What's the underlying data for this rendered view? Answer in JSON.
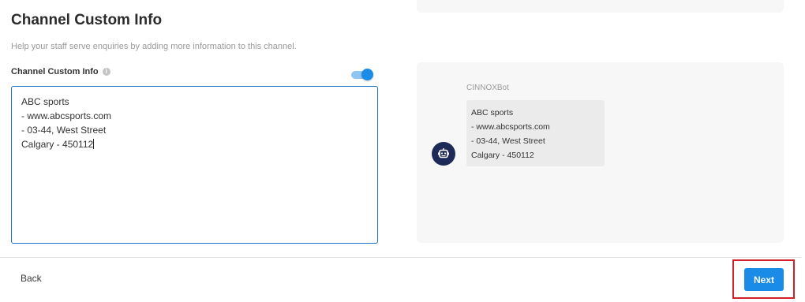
{
  "page": {
    "title": "Channel Custom Info",
    "subtitle": "Help your staff serve enquiries by adding more information to this channel."
  },
  "form": {
    "field_label": "Channel Custom Info",
    "info_icon": "i",
    "toggle_on": true,
    "textarea_value": "ABC sports\n- www.abcsports.com\n- 03-44, West Street\nCalgary - 450112"
  },
  "preview": {
    "bot_name": "CINNOXBot",
    "bot_avatar_icon": "robot-icon",
    "message": "ABC sports\n- www.abcsports.com\n- 03-44, West Street\nCalgary - 450112"
  },
  "footer": {
    "back_label": "Back",
    "next_label": "Next"
  },
  "colors": {
    "accent": "#1a8be6",
    "avatar_bg": "#1e2a57",
    "highlight": "#d32027"
  }
}
